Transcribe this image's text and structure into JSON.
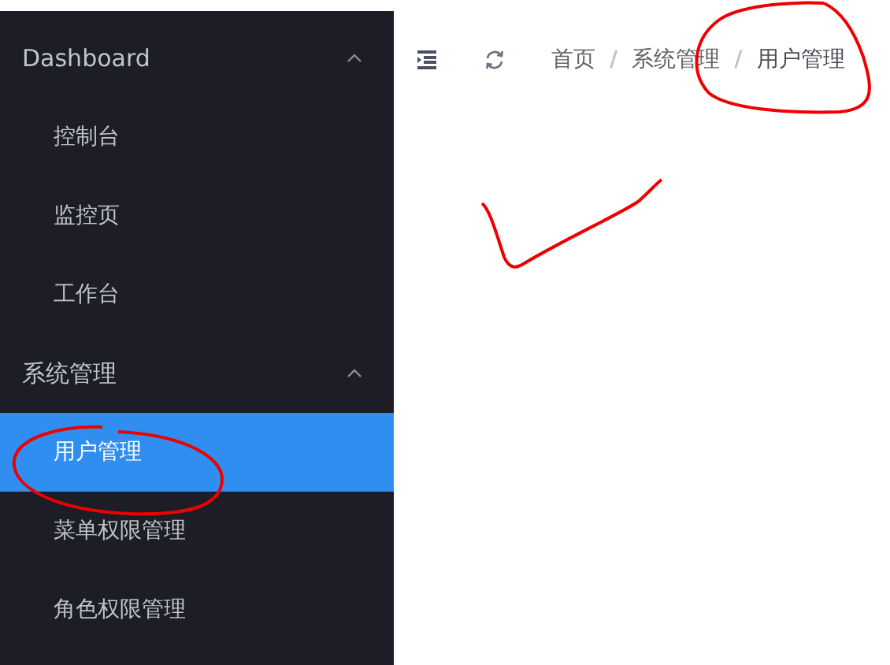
{
  "sidebar": {
    "groups": [
      {
        "title": "Dashboard",
        "expanded": true,
        "items": [
          {
            "label": "控制台",
            "selected": false
          },
          {
            "label": "监控页",
            "selected": false
          },
          {
            "label": "工作台",
            "selected": false
          }
        ]
      },
      {
        "title": "系统管理",
        "expanded": true,
        "items": [
          {
            "label": "用户管理",
            "selected": true
          },
          {
            "label": "菜单权限管理",
            "selected": false
          },
          {
            "label": "角色权限管理",
            "selected": false
          }
        ]
      }
    ]
  },
  "breadcrumb": {
    "separator": "/",
    "items": [
      {
        "label": "首页"
      },
      {
        "label": "系统管理"
      },
      {
        "label": "用户管理"
      }
    ]
  },
  "annotations": [
    {
      "kind": "ellipse"
    },
    {
      "kind": "ellipse"
    },
    {
      "kind": "check"
    }
  ]
}
